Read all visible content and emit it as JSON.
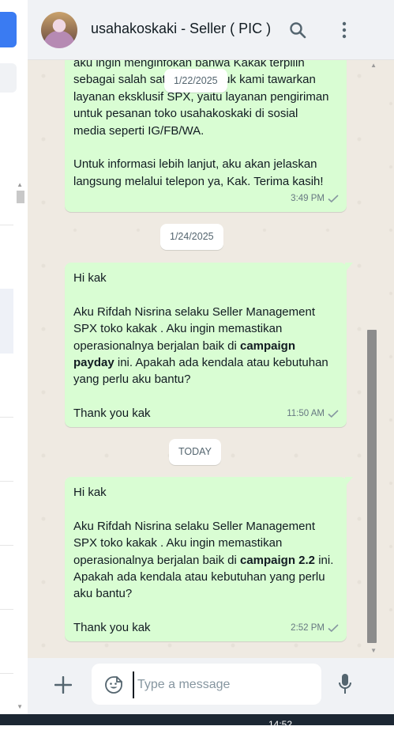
{
  "header": {
    "contact_name": "usahakoskaki - Seller ( PIC )",
    "icons": [
      "avatar",
      "search-icon",
      "kebab-menu-icon"
    ]
  },
  "messages": [
    {
      "paragraphs": [
        [
          "aku ingin menginfokan bahwa Kakak terpilih",
          "sebagai salah satu seller untuk kami tawarkan",
          "layanan eksklusif SPX, yaitu layanan pengiriman",
          "untuk pesanan toko  usahakoskaki  di sosial",
          "media seperti IG/FB/WA."
        ],
        [
          "Untuk informasi lebih lanjut, aku akan jelaskan",
          "langsung melalui telepon ya, Kak. Terima kasih!"
        ]
      ],
      "time": "3:49 PM",
      "status": "sent"
    },
    {
      "greeting": "Hi kak",
      "body_before": "Aku Rifdah Nisrina selaku Seller Management SPX toko kakak . Aku ingin memastikan operasionalnya berjalan baik di ",
      "highlight": "campaign payday",
      "body_after": " ini. Apakah ada kendala atau kebutuhan yang perlu aku bantu?",
      "closing": "Thank you kak",
      "time": "11:50 AM",
      "status": "sent"
    },
    {
      "greeting": "Hi kak",
      "body_before": "Aku Rifdah Nisrina selaku Seller Management SPX toko kakak . Aku ingin memastikan operasionalnya berjalan baik di ",
      "highlight": "campaign 2.2",
      "body_after": " ini. Apakah ada kendala atau kebutuhan yang perlu aku bantu?",
      "closing": "Thank you kak",
      "time": "2:52 PM",
      "status": "sent"
    }
  ],
  "date_chips": {
    "floating": "1/22/2025",
    "second": "1/24/2025",
    "today": "TODAY"
  },
  "composer": {
    "placeholder": "Type a message",
    "icons": [
      "plus-icon",
      "emoji-icon",
      "microphone-icon"
    ]
  },
  "taskbar": {
    "clock": "14:52"
  },
  "colors": {
    "outgoing_bubble": "#d9fdd3",
    "chat_background": "#efeae2",
    "header_background": "#f0f2f5",
    "accent_blue": "#3a7bf2"
  }
}
